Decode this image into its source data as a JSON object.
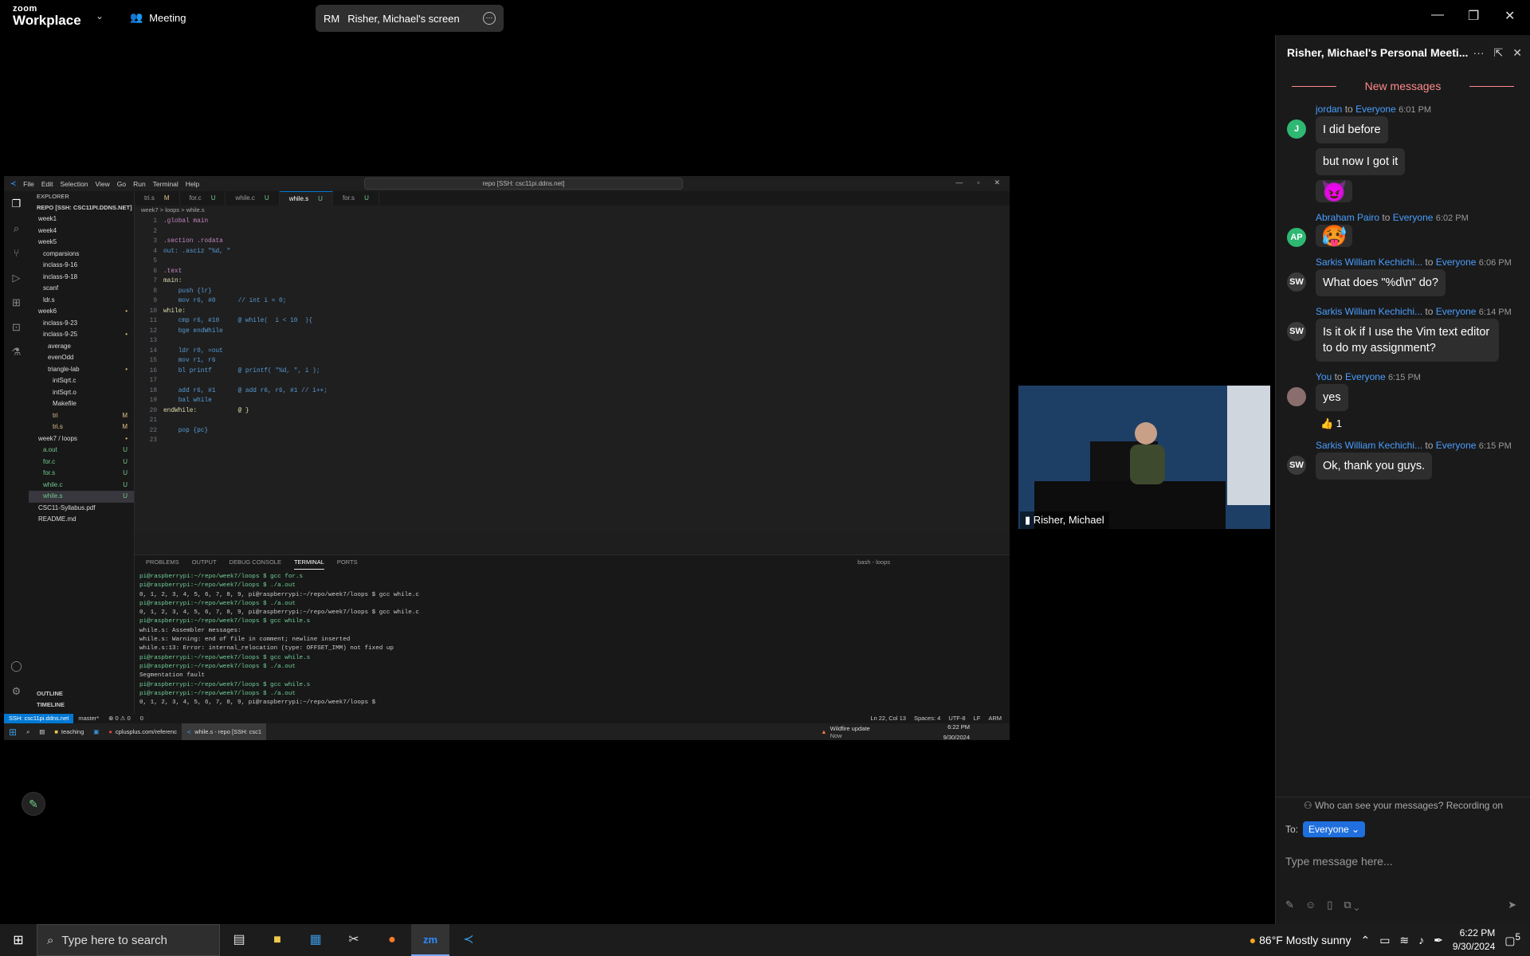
{
  "zoom": {
    "logo_top": "zoom",
    "logo_bottom": "Workplace",
    "meeting_label": "Meeting",
    "share_initials": "RM",
    "share_label": "Risher, Michael's screen"
  },
  "vscode": {
    "menu": [
      "File",
      "Edit",
      "Selection",
      "View",
      "Go",
      "Run",
      "Terminal",
      "Help"
    ],
    "search": "repo [SSH: csc11pi.ddns.net]",
    "explorer_title": "EXPLORER",
    "repo_label": "REPO [SSH: CSC11PI.DDNS.NET]",
    "tree": [
      {
        "name": "week1",
        "indent": 1,
        "badge": ""
      },
      {
        "name": "week4",
        "indent": 1,
        "badge": ""
      },
      {
        "name": "week5",
        "indent": 1,
        "badge": ""
      },
      {
        "name": "comparsions",
        "indent": 2,
        "badge": ""
      },
      {
        "name": "inclass-9-16",
        "indent": 2,
        "badge": ""
      },
      {
        "name": "inclass-9-18",
        "indent": 2,
        "badge": ""
      },
      {
        "name": "scanf",
        "indent": 2,
        "badge": ""
      },
      {
        "name": "ldr.s",
        "indent": 2,
        "badge": ""
      },
      {
        "name": "week6",
        "indent": 1,
        "badge": "•"
      },
      {
        "name": "inclass-9-23",
        "indent": 2,
        "badge": ""
      },
      {
        "name": "inclass-9-25",
        "indent": 2,
        "badge": "•"
      },
      {
        "name": "average",
        "indent": 3,
        "badge": ""
      },
      {
        "name": "evenOdd",
        "indent": 3,
        "badge": ""
      },
      {
        "name": "triangle-lab",
        "indent": 3,
        "badge": "•"
      },
      {
        "name": "intSqrt.c",
        "indent": 4,
        "badge": ""
      },
      {
        "name": "intSqrt.o",
        "indent": 4,
        "badge": ""
      },
      {
        "name": "Makefile",
        "indent": 4,
        "badge": ""
      },
      {
        "name": "tri",
        "indent": 4,
        "badge": "M"
      },
      {
        "name": "tri.s",
        "indent": 4,
        "badge": "M"
      },
      {
        "name": "week7 / loops",
        "indent": 1,
        "badge": "•"
      },
      {
        "name": "a.out",
        "indent": 2,
        "badge": "U"
      },
      {
        "name": "for.c",
        "indent": 2,
        "badge": "U"
      },
      {
        "name": "for.s",
        "indent": 2,
        "badge": "U"
      },
      {
        "name": "while.c",
        "indent": 2,
        "badge": "U"
      },
      {
        "name": "while.s",
        "indent": 2,
        "badge": "U"
      },
      {
        "name": "CSC11-Syllabus.pdf",
        "indent": 1,
        "badge": ""
      },
      {
        "name": "README.md",
        "indent": 1,
        "badge": ""
      }
    ],
    "outline": "OUTLINE",
    "timeline": "TIMELINE",
    "tabs": [
      {
        "name": "tri.s",
        "flag": "M"
      },
      {
        "name": "for.c",
        "flag": "U"
      },
      {
        "name": "while.c",
        "flag": "U"
      },
      {
        "name": "while.s",
        "flag": "U"
      },
      {
        "name": "for.s",
        "flag": "U"
      }
    ],
    "breadcrumb": "week7 > loops > while.s",
    "code": [
      ".global main",
      "",
      ".section .rodata",
      "out: .asciz \"%d, \"",
      "",
      ".text",
      "main:",
      "    push {lr}",
      "    mov r6, #0      // int i = 0;",
      "while:",
      "    cmp r6, #10     @ while(  i < 10  ){",
      "    bge endWhile",
      "",
      "    ldr r0, =out",
      "    mov r1, r6",
      "    bl printf       @ printf( \"%d, \", i );",
      "",
      "    add r6, #1      @ add r6, r6, #1 // i++;",
      "    bal while",
      "endWhile:           @ }",
      "",
      "    pop {pc}",
      ""
    ],
    "panel_tabs": [
      "PROBLEMS",
      "OUTPUT",
      "DEBUG CONSOLE",
      "TERMINAL",
      "PORTS"
    ],
    "terminal_name": "bash - loops",
    "terminal": [
      "pi@raspberrypi:~/repo/week7/loops $ gcc for.s",
      "pi@raspberrypi:~/repo/week7/loops $ ./a.out",
      "0, 1, 2, 3, 4, 5, 6, 7, 8, 9, pi@raspberrypi:~/repo/week7/loops $ gcc while.c",
      "pi@raspberrypi:~/repo/week7/loops $ ./a.out",
      "0, 1, 2, 3, 4, 5, 6, 7, 8, 9, pi@raspberrypi:~/repo/week7/loops $ gcc while.c",
      "pi@raspberrypi:~/repo/week7/loops $ gcc while.s",
      "while.s: Assembler messages:",
      "while.s: Warning: end of file in comment; newline inserted",
      "while.s:13: Error: internal_relocation (type: OFFSET_IMM) not fixed up",
      "pi@raspberrypi:~/repo/week7/loops $ gcc while.s",
      "pi@raspberrypi:~/repo/week7/loops $ ./a.out",
      "Segmentation fault",
      "pi@raspberrypi:~/repo/week7/loops $ gcc while.s",
      "pi@raspberrypi:~/repo/week7/loops $ ./a.out",
      "0, 1, 2, 3, 4, 5, 6, 7, 8, 9, pi@raspberrypi:~/repo/week7/loops $ "
    ],
    "status_remote": "SSH: csc11pi.ddns.net",
    "status_branch": "master*",
    "status_problems": "⊗ 0 ⚠ 0",
    "status_ports": "0",
    "status_right": [
      "Ln 22, Col 13",
      "Spaces: 4",
      "UTF-8",
      "LF",
      "ARM"
    ],
    "taskbar_items": [
      "teaching",
      "cplusplus.com/referenc",
      "while.s - repo [SSH: csc1"
    ],
    "taskbar_weather_title": "Wildfire update",
    "taskbar_weather_sub": "Now",
    "taskbar_time": "6:22 PM",
    "taskbar_date": "9/30/2024"
  },
  "video": {
    "name": "Risher, Michael"
  },
  "chat": {
    "title": "Risher, Michael's Personal Meeti...",
    "new_messages": "New messages",
    "messages": [
      {
        "sender": "jordan",
        "to": "to",
        "target": "Everyone",
        "time": "6:01 PM",
        "avatar": "J",
        "color": "#2eb872",
        "texts": [
          "I did before",
          "but now I got it"
        ],
        "emoji": "😈"
      },
      {
        "sender": "Abraham Pairo",
        "to": "to",
        "target": "Everyone",
        "time": "6:02 PM",
        "avatar": "AP",
        "color": "#2eb872",
        "texts": [],
        "emoji": "🥵"
      },
      {
        "sender": "Sarkis William Kechichi...",
        "to": "to",
        "target": "Everyone",
        "time": "6:06 PM",
        "avatar": "SW",
        "color": "#3a3a3a",
        "texts": [
          "What does \"%d\\n\" do?"
        ],
        "emoji": ""
      },
      {
        "sender": "Sarkis William Kechichi...",
        "to": "to",
        "target": "Everyone",
        "time": "6:14 PM",
        "avatar": "SW",
        "color": "#3a3a3a",
        "texts": [
          "Is it ok if I use the Vim text editor to do my assignment?"
        ],
        "emoji": ""
      },
      {
        "sender": "You",
        "to": "to",
        "target": "Everyone",
        "time": "6:15 PM",
        "avatar": "",
        "color": "#8a6e6e",
        "texts": [
          "yes"
        ],
        "emoji": ""
      },
      {
        "sender": "Sarkis William Kechichi...",
        "to": "to",
        "target": "Everyone",
        "time": "6:15 PM",
        "avatar": "SW",
        "color": "#3a3a3a",
        "texts": [
          "Ok, thank you guys."
        ],
        "emoji": ""
      }
    ],
    "reaction": "👍 1",
    "visibility": "Who can see your messages? Recording on",
    "to_label": "To:",
    "to_value": "Everyone",
    "input_placeholder": "Type message here..."
  },
  "taskbar": {
    "search_placeholder": "Type here to search",
    "weather": "86°F  Mostly sunny",
    "time": "6:22 PM",
    "date": "9/30/2024",
    "notifications": "5"
  }
}
